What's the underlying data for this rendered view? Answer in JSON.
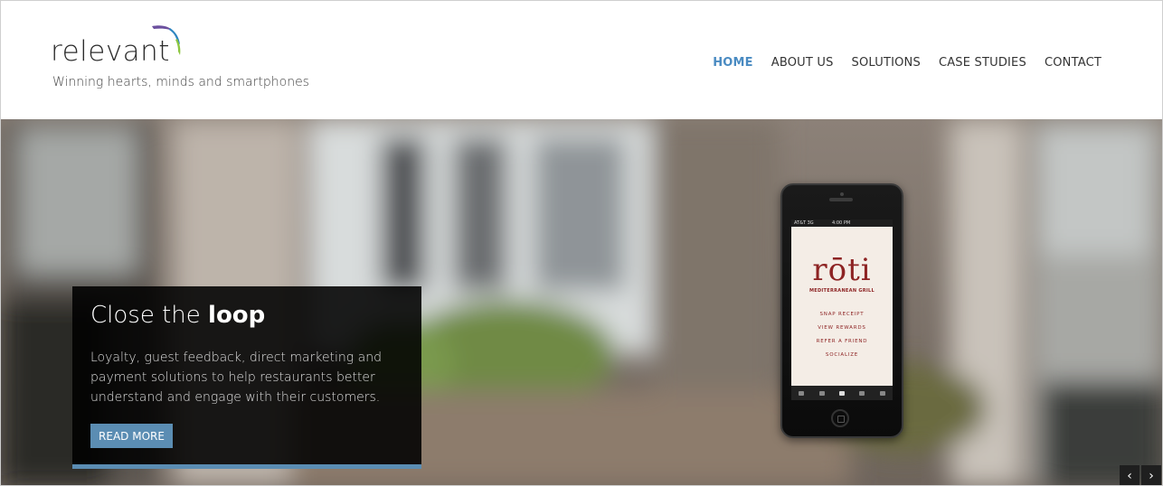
{
  "brand": {
    "name": "relevant",
    "tagline": "Winning hearts, minds and smartphones"
  },
  "nav": {
    "items": [
      {
        "label": "HOME",
        "active": true
      },
      {
        "label": "ABOUT US",
        "active": false
      },
      {
        "label": "SOLUTIONS",
        "active": false
      },
      {
        "label": "CASE STUDIES",
        "active": false
      },
      {
        "label": "CONTACT",
        "active": false
      }
    ]
  },
  "hero": {
    "title_prefix": "Close the",
    "title_bold": "loop",
    "body": "Loyalty, guest feedback, direct marketing and payment solutions to help restaurants better understand and engage with their customers.",
    "button_label": "READ MORE",
    "prev_icon": "chevron-left-icon",
    "next_icon": "chevron-right-icon",
    "prev_glyph": "‹",
    "next_glyph": "›"
  },
  "phone": {
    "carrier": "AT&T 3G",
    "time": "4:00 PM",
    "app_logo": "rōti",
    "app_subtitle": "MEDITERRANEAN GRILL",
    "menu": [
      "SNAP RECEIPT",
      "VIEW REWARDS",
      "REFER A FRIEND",
      "SOCIALIZE"
    ]
  },
  "colors": {
    "accent": "#4a8bc2",
    "button": "#5b8db3",
    "caption_bg": "#000000",
    "roti_red": "#8d2323"
  }
}
